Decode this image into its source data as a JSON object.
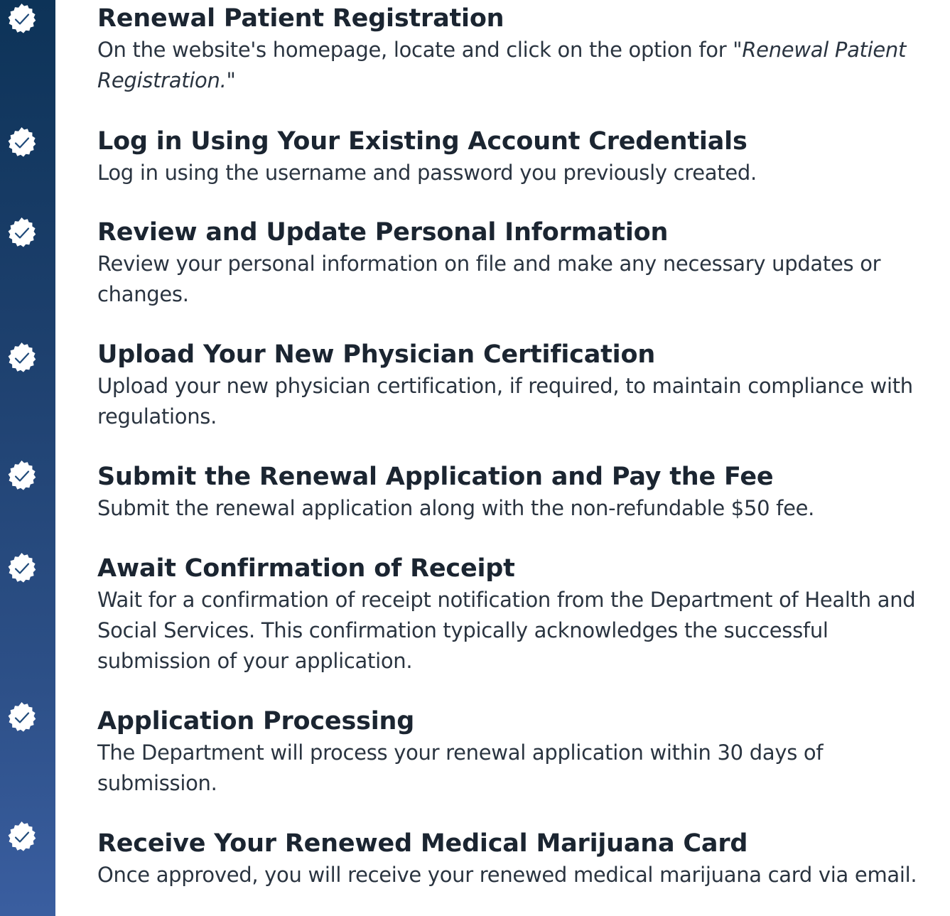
{
  "steps": [
    {
      "title": "Renewal Patient Registration",
      "desc_before": "On the website's homepage, locate and click on the option for \"",
      "desc_emphasis": "Renewal Patient Registration.",
      "desc_after": "\"",
      "icon": "check-badge-icon"
    },
    {
      "title": "Log in Using Your Existing Account Credentials",
      "desc": "Log in using the username and password you previously created.",
      "icon": "check-badge-icon"
    },
    {
      "title": "Review and Update Personal Information",
      "desc": "Review your personal information on file and make any necessary updates or changes.",
      "icon": "check-badge-icon"
    },
    {
      "title": "Upload Your New Physician Certification",
      "desc": "Upload your new physician certification, if required, to maintain compliance with regulations.",
      "icon": "check-badge-icon"
    },
    {
      "title": "Submit the Renewal Application and Pay the Fee",
      "desc": "Submit the renewal application along with the non-refundable $50 fee.",
      "icon": "check-badge-icon"
    },
    {
      "title": "Await Confirmation of Receipt",
      "desc": "Wait for a confirmation of receipt notification from the Department of Health and Social Services. This confirmation typically acknowledges the successful submission of your application.",
      "icon": "check-badge-icon"
    },
    {
      "title": "Application Processing",
      "desc": "The Department will process your renewal application within 30 days of submission.",
      "icon": "check-badge-icon"
    },
    {
      "title": "Receive Your Renewed Medical Marijuana Card",
      "desc": "Once approved, you will receive your renewed medical marijuana card via email.",
      "icon": "check-badge-icon"
    }
  ],
  "colors": {
    "rail_top": "#0d3358",
    "rail_bottom": "#3a5ea0",
    "badge": "#ffffff",
    "check_stroke": "#1f4a7a",
    "title_text": "#1b2531",
    "body_text": "#2a3440"
  }
}
